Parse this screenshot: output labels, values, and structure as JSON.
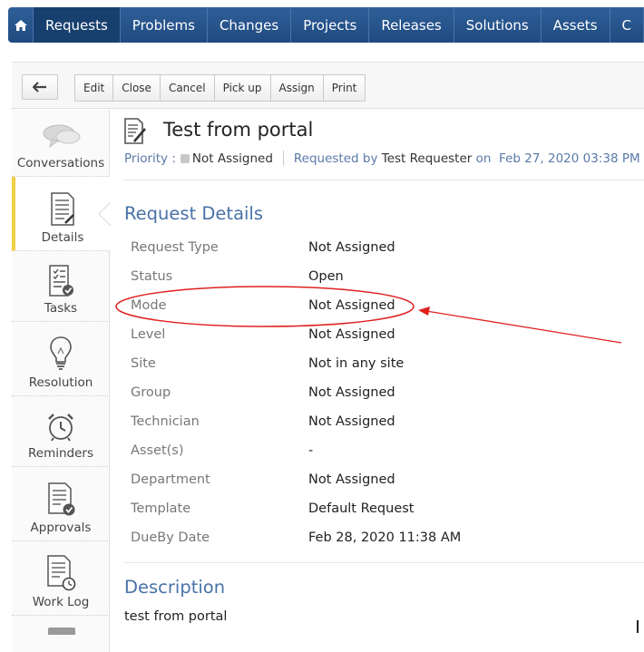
{
  "nav": {
    "items": [
      "Requests",
      "Problems",
      "Changes",
      "Projects",
      "Releases",
      "Solutions",
      "Assets",
      "C"
    ],
    "active_index": 0
  },
  "toolbar": {
    "buttons": [
      "Edit",
      "Close",
      "Cancel",
      "Pick up",
      "Assign",
      "Print"
    ]
  },
  "sidebar": {
    "tabs": [
      {
        "label": "Conversations",
        "icon": "speech-bubbles-icon"
      },
      {
        "label": "Details",
        "icon": "document-icon"
      },
      {
        "label": "Tasks",
        "icon": "checklist-icon"
      },
      {
        "label": "Resolution",
        "icon": "lightbulb-icon"
      },
      {
        "label": "Reminders",
        "icon": "alarm-clock-icon"
      },
      {
        "label": "Approvals",
        "icon": "document-check-icon"
      },
      {
        "label": "Work Log",
        "icon": "document-clock-icon"
      }
    ],
    "active": "Details"
  },
  "request": {
    "title": "Test from portal",
    "priority_label": "Priority :",
    "priority_value": "Not Assigned",
    "requested_by_label": "Requested by",
    "requester": "Test Requester",
    "on_label": "on",
    "date": "Feb 27, 2020 03:38 PM"
  },
  "details": {
    "heading": "Request Details",
    "rows": [
      {
        "label": "Request Type",
        "value": "Not Assigned"
      },
      {
        "label": "Status",
        "value": "Open"
      },
      {
        "label": "Mode",
        "value": "Not Assigned"
      },
      {
        "label": "Level",
        "value": "Not Assigned"
      },
      {
        "label": "Site",
        "value": "Not in any site"
      },
      {
        "label": "Group",
        "value": "Not Assigned"
      },
      {
        "label": "Technician",
        "value": "Not Assigned"
      },
      {
        "label": "Asset(s)",
        "value": "-"
      },
      {
        "label": "Department",
        "value": "Not Assigned"
      },
      {
        "label": "Template",
        "value": "Default Request"
      },
      {
        "label": "DueBy Date",
        "value": "Feb 28, 2020 11:38 AM"
      }
    ]
  },
  "description": {
    "heading": "Description",
    "text": "test from portal"
  },
  "colors": {
    "nav_bg": "#1f4a80",
    "nav_active": "#18406f",
    "link_blue": "#4a72a8",
    "annotation_red": "#e02020",
    "active_tab_accent": "#f1cf44"
  }
}
